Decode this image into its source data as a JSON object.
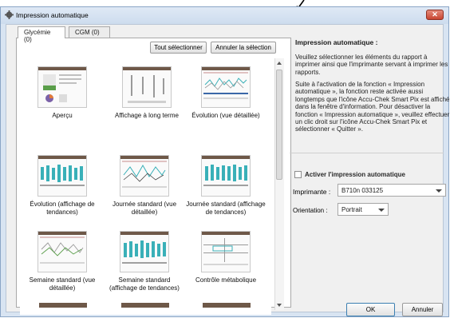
{
  "window": {
    "title": "Impression automatique",
    "close_icon": "close-icon",
    "app_icon": "gear-icon"
  },
  "tabs": [
    {
      "label": "Glycémie (0)",
      "active": true
    },
    {
      "label": "CGM (0)",
      "active": false
    }
  ],
  "toolbar": {
    "select_all": "Tout sélectionner",
    "unselect": "Annuler la sélection"
  },
  "reports": [
    {
      "label": "Aperçu"
    },
    {
      "label": "Affichage à long terme"
    },
    {
      "label": "Évolution (vue détaillée)"
    },
    {
      "label": "Évolution (affichage de tendances)"
    },
    {
      "label": "Journée standard (vue détaillée)"
    },
    {
      "label": "Journée standard (affichage de tendances)"
    },
    {
      "label": "Semaine standard (vue détaillée)"
    },
    {
      "label": "Semaine standard (affichage de tendances)"
    },
    {
      "label": "Contrôle métabolique"
    }
  ],
  "info": {
    "title": "Impression automatique :",
    "paragraph1": "Veuillez sélectionner les éléments du rapport à imprimer ainsi que l'imprimante servant à imprimer les rapports.",
    "paragraph2": "Suite à l'activation de la fonction « Impression automatique », la fonction reste activée aussi longtemps que l'icône Accu-Chek Smart Pix est affiché dans la fenêtre d'information. Pour désactiver la fonction « Impression automatique », veuillez effectuer un clic droit sur l'icône Accu-Chek Smart Pix et sélectionner « Quitter »."
  },
  "settings": {
    "activate_label": "Activer l'impression automatique",
    "activate_checked": false,
    "printer_label": "Imprimante :",
    "printer_value": "B710n 033125",
    "orientation_label": "Orientation :",
    "orientation_value": "Portrait"
  },
  "footer": {
    "ok": "OK",
    "cancel": "Annuler"
  },
  "colors": {
    "accent": "#3c7fb1",
    "thumb_header": "#6e5848",
    "chart_teal": "#39b0b8",
    "chart_green": "#5a9e4a"
  }
}
